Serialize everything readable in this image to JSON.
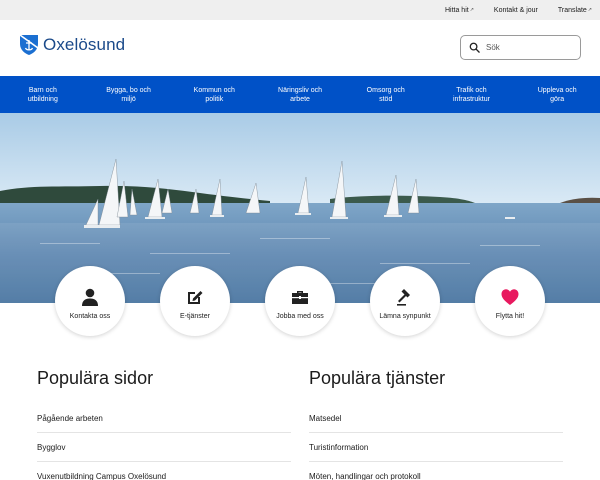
{
  "top_links": [
    {
      "label": "Hitta hit",
      "external": true
    },
    {
      "label": "Kontakt & jour",
      "external": false
    },
    {
      "label": "Translate",
      "external": true
    }
  ],
  "logo": {
    "text": "Oxelösund"
  },
  "search": {
    "placeholder": "Sök"
  },
  "nav": [
    {
      "line1": "Barn och",
      "line2": "utbildning"
    },
    {
      "line1": "Bygga, bo och",
      "line2": "miljö"
    },
    {
      "line1": "Kommun och",
      "line2": "politik"
    },
    {
      "line1": "Näringsliv och",
      "line2": "arbete"
    },
    {
      "line1": "Omsorg och",
      "line2": "stöd"
    },
    {
      "line1": "Trafik och",
      "line2": "infrastruktur"
    },
    {
      "line1": "Uppleva och",
      "line2": "göra"
    }
  ],
  "quick_links": [
    {
      "label": "Kontakta oss",
      "icon": "person-icon"
    },
    {
      "label": "E-tjänster",
      "icon": "edit-icon"
    },
    {
      "label": "Jobba med oss",
      "icon": "briefcase-icon"
    },
    {
      "label": "Lämna synpunkt",
      "icon": "gavel-icon"
    },
    {
      "label": "Flytta hit!",
      "icon": "heart-icon"
    }
  ],
  "popular_pages": {
    "title": "Populära sidor",
    "items": [
      "Pågående arbeten",
      "Bygglov",
      "Vuxenutbildning Campus Oxelösund"
    ]
  },
  "popular_services": {
    "title": "Populära tjänster",
    "items": [
      "Matsedel",
      "Turistinformation",
      "Möten, handlingar och protokoll"
    ]
  },
  "colors": {
    "nav_bg": "#0051c7",
    "brand_text": "#1b4a8a",
    "heart": "#e8195f",
    "top_bar": "#efefef"
  }
}
